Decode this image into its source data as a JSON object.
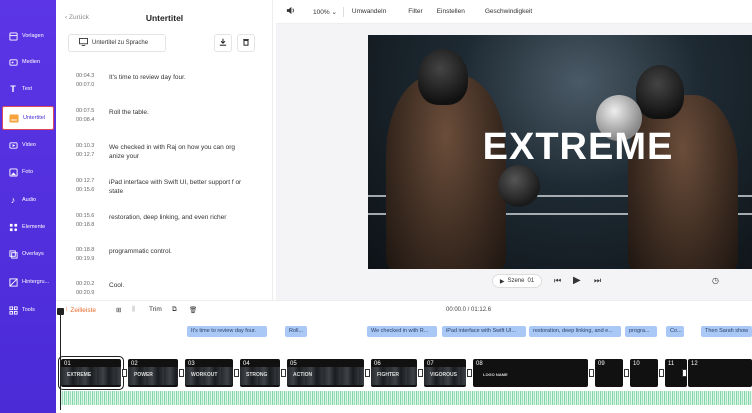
{
  "sidebar": {
    "items": [
      {
        "label": "Vorlagen",
        "icon": "templates-icon"
      },
      {
        "label": "Medien",
        "icon": "media-icon"
      },
      {
        "label": "Text",
        "icon": "text-icon"
      },
      {
        "label": "Untertitel",
        "icon": "subtitles-icon",
        "active": true
      },
      {
        "label": "Video",
        "icon": "video-icon"
      },
      {
        "label": "Foto",
        "icon": "photo-icon"
      },
      {
        "label": "Audio",
        "icon": "audio-icon"
      },
      {
        "label": "Elemente",
        "icon": "elements-icon"
      },
      {
        "label": "Overlays",
        "icon": "overlays-icon"
      },
      {
        "label": "Hintergru...",
        "icon": "background-icon"
      },
      {
        "label": "Tools",
        "icon": "tools-icon"
      }
    ]
  },
  "panel": {
    "back_label": "Zurück",
    "title": "Untertitel",
    "lang_button": "Untertitel zu Sprache",
    "subtitles": [
      {
        "start": "00:04.3",
        "end": "00:07.0",
        "text": "It's time to review day four."
      },
      {
        "start": "00:07.5",
        "end": "00:08.4",
        "text": "Roll the table."
      },
      {
        "start": "00:10.3",
        "end": "00:12.7",
        "text": "We checked in with Raj on how you can org anize your"
      },
      {
        "start": "00:12.7",
        "end": "00:15.6",
        "text": "iPad interface with Swift UI, better support f or state"
      },
      {
        "start": "00:15.6",
        "end": "00:18.8",
        "text": "restoration, deep linking, and even richer"
      },
      {
        "start": "00:18.8",
        "end": "00:19.9",
        "text": "programmatic control."
      },
      {
        "start": "00:20.2",
        "end": "00:20.9",
        "text": "Cool."
      }
    ]
  },
  "toolbar": {
    "zoom": "100%",
    "items": [
      "Umwandeln",
      "Filter",
      "Einstellen",
      "Geschwindigkeit"
    ]
  },
  "preview": {
    "title_text": "EXTREME",
    "scene_label": "Szene",
    "scene_number": "01"
  },
  "timeline": {
    "split_label": "Zeilleiste",
    "trim_label": "Trim",
    "timecode": "00:00.0 / 01:12.6",
    "subtitle_chips": [
      "It's time to review day four.",
      "Roll...",
      "We checked in with R...",
      "iPad interface with Swift UI...",
      "restoration, deep linking, and e...",
      "progra...",
      "Co...",
      "Then Sarah show"
    ],
    "clips": [
      {
        "num": "01",
        "label": "EXTREME"
      },
      {
        "num": "02",
        "label": "POWER"
      },
      {
        "num": "03",
        "label": "WORKOUT"
      },
      {
        "num": "04",
        "label": "STRONG"
      },
      {
        "num": "05",
        "label": "ACTION"
      },
      {
        "num": "06",
        "label": "FIGHTER"
      },
      {
        "num": "07",
        "label": "VIGOROUS"
      },
      {
        "num": "08",
        "label": "LOGO NAME"
      },
      {
        "num": "09",
        "label": ""
      },
      {
        "num": "10",
        "label": ""
      },
      {
        "num": "11",
        "label": ""
      },
      {
        "num": "12",
        "label": ""
      }
    ]
  }
}
